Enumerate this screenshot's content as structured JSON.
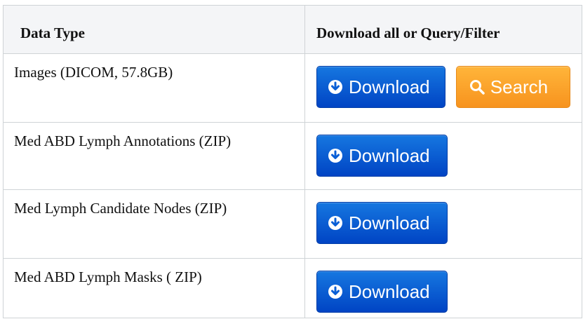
{
  "table": {
    "headers": [
      "Data Type",
      "Download all or Query/Filter"
    ],
    "rows": [
      {
        "data_type": "Images (DICOM, 57.8GB)",
        "download_label": "Download",
        "search_label": "Search"
      },
      {
        "data_type": "Med ABD Lymph Annotations (ZIP)",
        "download_label": "Download"
      },
      {
        "data_type": "Med Lymph Candidate Nodes (ZIP)",
        "download_label": "Download"
      },
      {
        "data_type": "Med ABD Lymph Masks ( ZIP)",
        "download_label": "Download"
      }
    ]
  },
  "icons": {
    "download": "circle-arrow-down-icon",
    "search": "search-icon"
  },
  "colors": {
    "download_button": "#0a5fd6",
    "search_button": "#f9a12b",
    "header_bg": "#f4f5f7",
    "border": "#cfd3d6"
  }
}
